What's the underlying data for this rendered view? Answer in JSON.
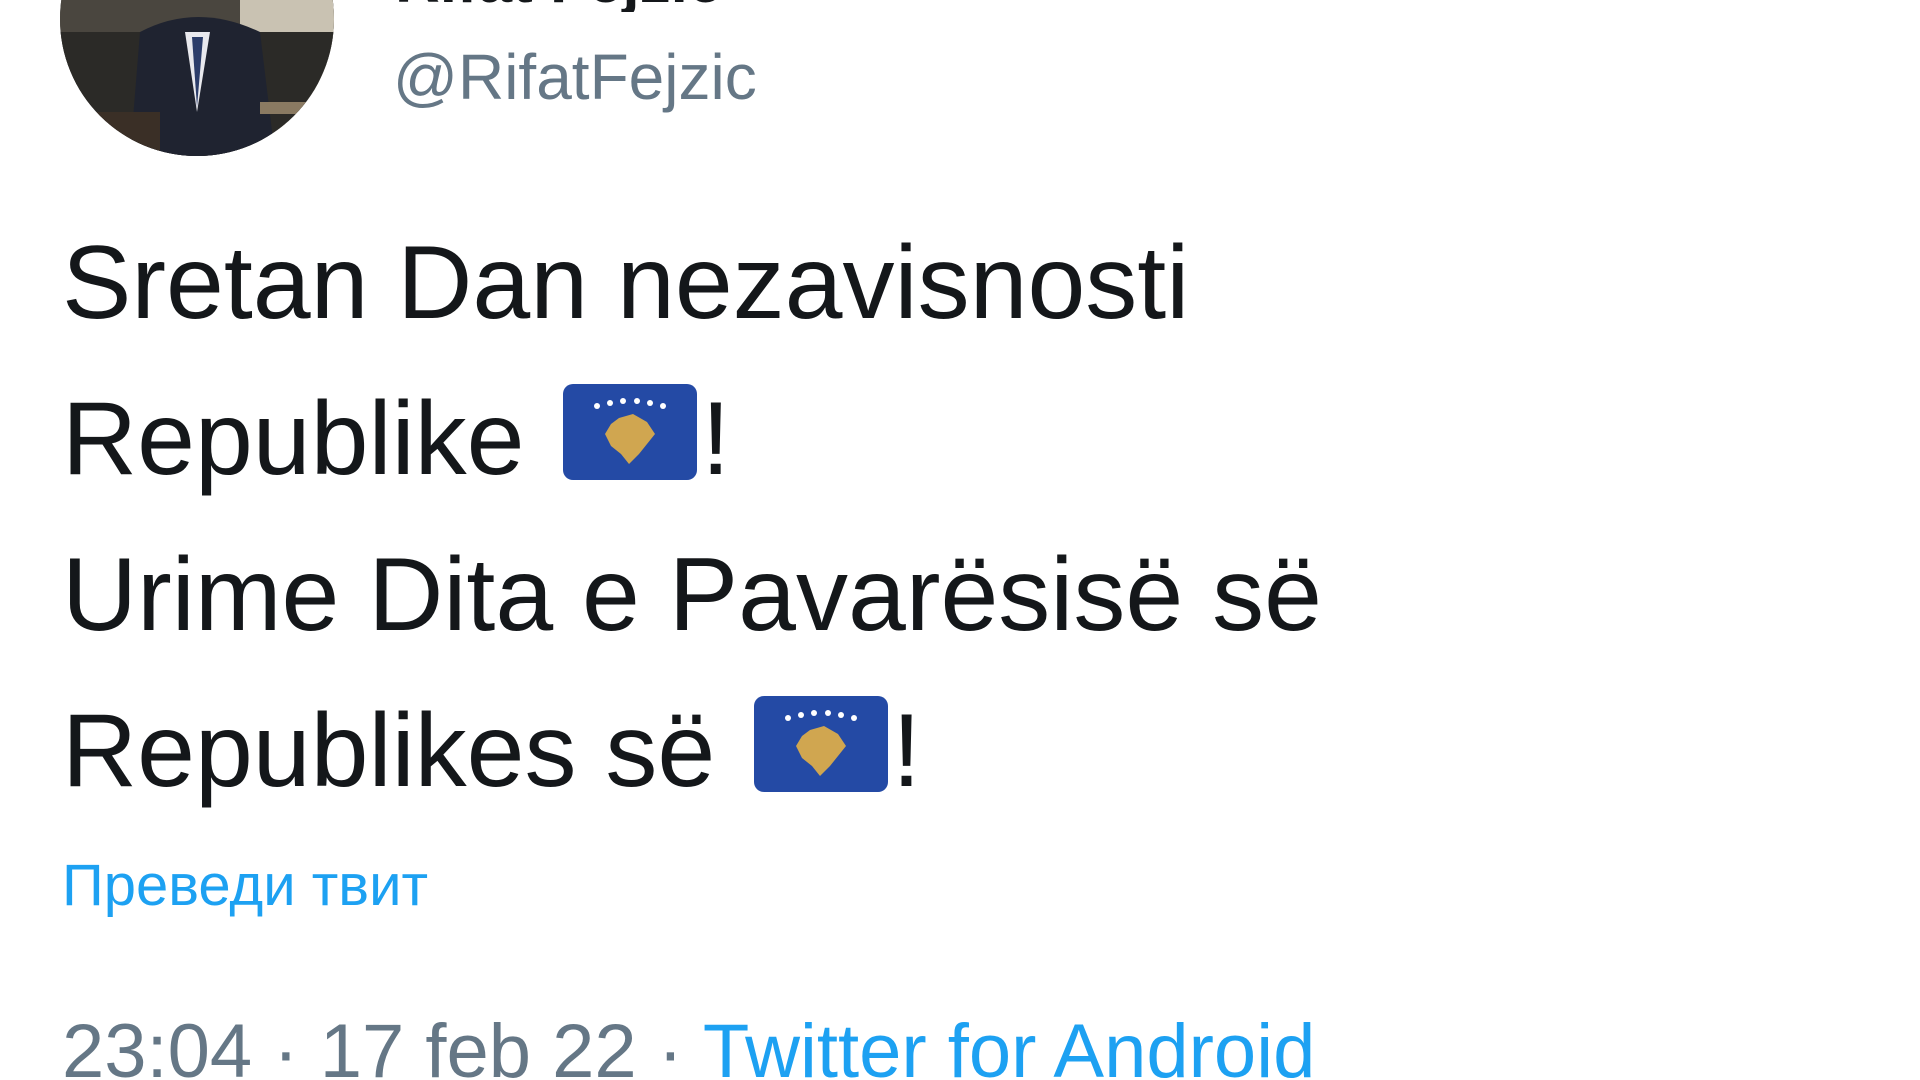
{
  "profile": {
    "display_name": "Rifat Fejzić",
    "handle": "@RifatFejzic"
  },
  "tweet": {
    "line1": "Sretan Dan nezavisnosti",
    "line2_text": "Republike ",
    "line2_after": "!",
    "line3": "Urime Dita e Pavarësisë së",
    "line4_text": "Republikes së ",
    "line4_after": "!"
  },
  "icons": {
    "flag": "kosovo-flag-emoji",
    "avatar": "profile-photo"
  },
  "translate_label": "Преведи твит",
  "meta": {
    "time": "23:04",
    "separator": " · ",
    "date": "17 feb 22",
    "source": "Twitter for Android"
  },
  "colors": {
    "text": "#14171a",
    "secondary": "#657786",
    "link": "#1da1f2",
    "flag_blue": "#244AA5",
    "flag_gold": "#D0A650"
  }
}
